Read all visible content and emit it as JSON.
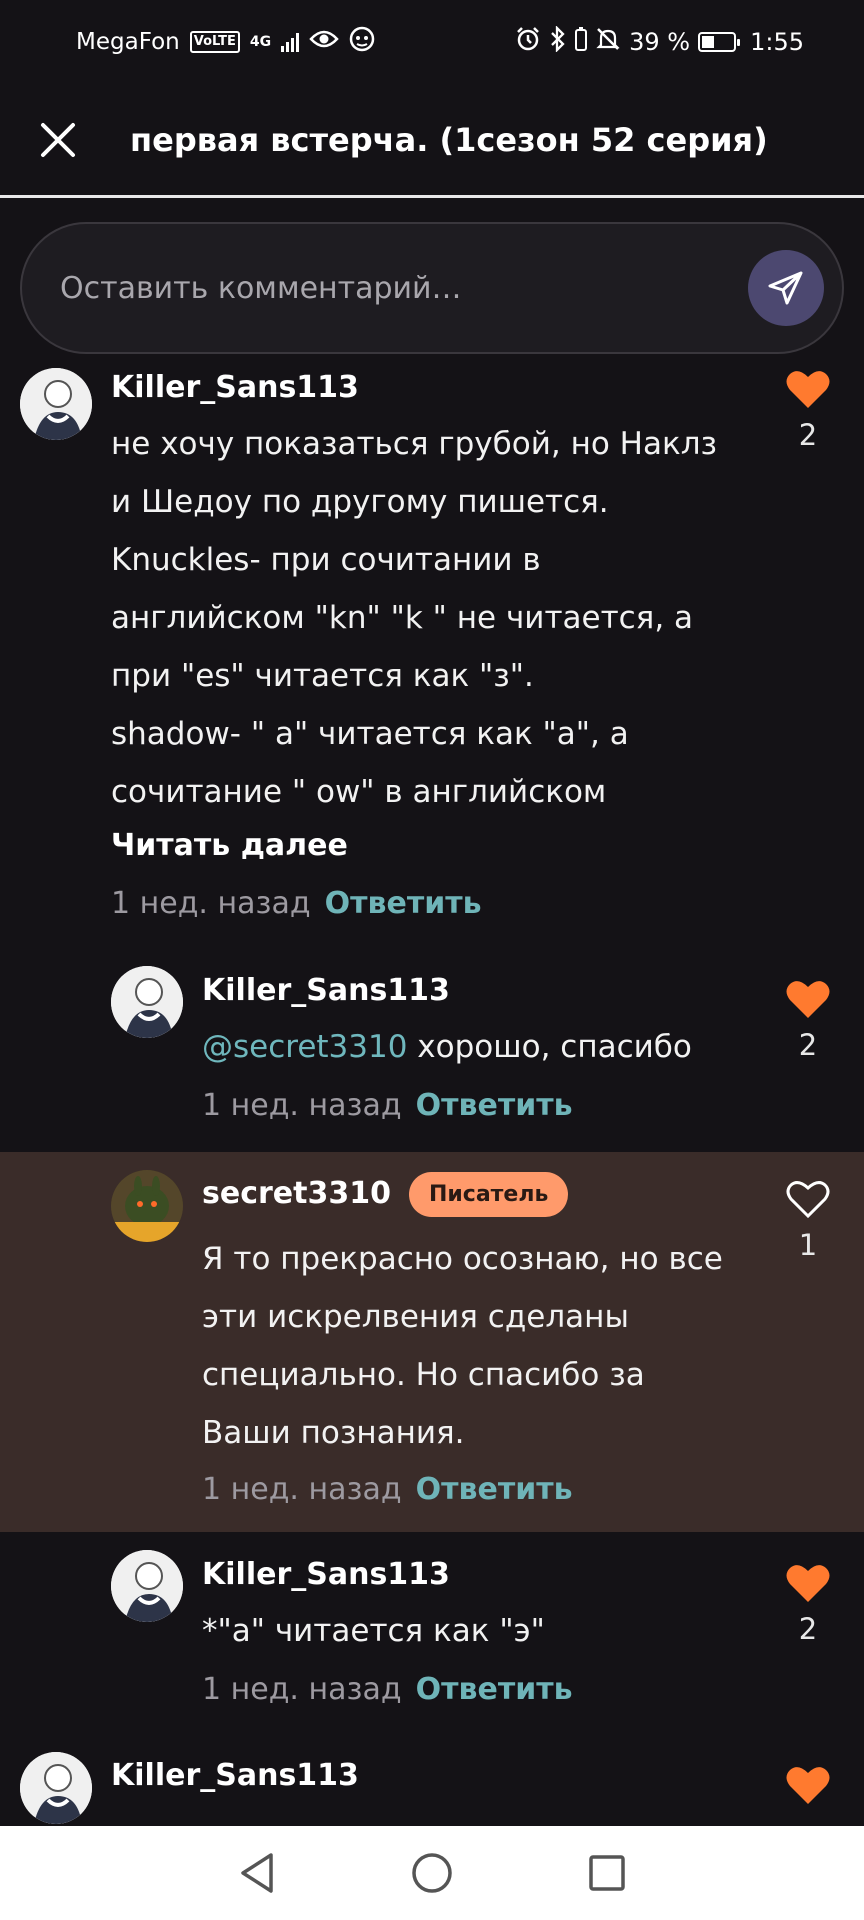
{
  "status_bar": {
    "carrier": "MegaFon",
    "volte": "VoLTE",
    "network": "4G",
    "battery_percent": "39 %",
    "battery_level": 0.39,
    "time": "1:55",
    "icons": [
      "eye-icon",
      "notification-app-icon",
      "alarm-icon",
      "bluetooth-icon",
      "mute-icon",
      "battery-icon"
    ]
  },
  "header": {
    "title": "первая встерча. (1сезон 52 серия)",
    "close_icon": "close-icon"
  },
  "comment_input": {
    "placeholder": "Оставить комментарий…",
    "send_icon": "send-icon"
  },
  "colors": {
    "background": "#141216",
    "accent_heart": "#ff7a2f",
    "reply_link": "#6fb4b8",
    "badge": "#ff9a6b",
    "highlight_row": "#3a2c29"
  },
  "comments": [
    {
      "username": "Killer_Sans113",
      "lines": [
        "не хочу показаться грубой, но Наклз",
        "и Шедоу по другому пишется.",
        "Knuckles- при сочитании в",
        "английском \"kn\" \"k \" не читается, а",
        "при \"es\" читается как \"з\".",
        "shadow- \" a\" читается как \"а\", а",
        "сочитание \" ow\" в английском"
      ],
      "read_more": "Читать далее",
      "time": "1 нед. назад",
      "reply": "Ответить",
      "likes": "2",
      "liked": true
    },
    {
      "username": "Killer_Sans113",
      "mention": "@secret3310",
      "text": " хорошо, спасибо",
      "time": "1 нед. назад",
      "reply": "Ответить",
      "likes": "2",
      "liked": true
    },
    {
      "username": "secret3310",
      "badge": "Писатель",
      "lines": [
        "Я то прекрасно осознаю, но все",
        "эти искрелвения сделаны",
        "специально. Но спасибо за",
        "Ваши познания."
      ],
      "time": "1 нед. назад",
      "reply": "Ответить",
      "likes": "1",
      "liked": false
    },
    {
      "username": "Killer_Sans113",
      "text": "*\"а\" читается как \"э\"",
      "time": "1 нед. назад",
      "reply": "Ответить",
      "likes": "2",
      "liked": true
    },
    {
      "username": "Killer_Sans113",
      "liked": true
    }
  ],
  "nav_bar": {
    "icons": [
      "back-icon",
      "home-icon",
      "recents-icon"
    ]
  }
}
